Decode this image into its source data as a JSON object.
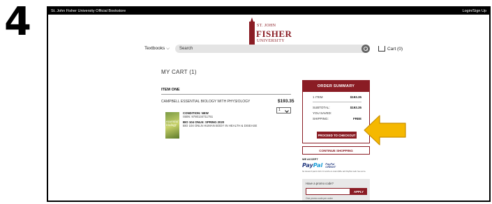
{
  "step": {
    "number": "4"
  },
  "topbar": {
    "store_name": "St. John Fisher University Official Bookstore",
    "login": "Login/Sign Up"
  },
  "logo": {
    "line1": "ST. JOHN",
    "line2": "FISHER",
    "line3": "UNIVERSITY"
  },
  "nav": {
    "textbooks": "Textbooks",
    "search_placeholder": "Search",
    "cart": "Cart (0)"
  },
  "cart": {
    "heading": "MY CART (1)",
    "item_label": "ITEM ONE",
    "product_title": "CAMPBELL ESSENTIAL BIOLOGY WITH PHYSIOLOGY",
    "price": "$193.35",
    "qty": "1",
    "book_cover_text": "essential biology",
    "condition": "CONDITION: NEW",
    "isbn": "ISBN: 9780134711751",
    "course1": "BIO 104 ONLN: SPRING 2020",
    "course2": "BIO 104 ONLN HUMAN BODY IN HEALTH & DISEASE"
  },
  "summary": {
    "heading": "ORDER SUMMARY",
    "items_label": "1 ITEM",
    "items_value": "$193.35",
    "subtotal_label": "SUBTOTAL:",
    "subtotal_value": "$193.35",
    "saved_label": "YOU SAVED:",
    "shipping_label": "SHIPPING:",
    "shipping_value": "FREE",
    "checkout": "PROCEED TO CHECKOUT"
  },
  "continue": "CONTINUE SHOPPING",
  "payment": {
    "we_accept": "WE ACCEPT",
    "paypal_p1": "Pay",
    "paypal_p2": "Pal",
    "credit_top": "PayPal",
    "credit_bottom": "CREDIT",
    "note": "No interest if paid in full in 6 months on orders $99+ with PayPal credit. See terms."
  },
  "promo": {
    "question": "Have a promo code?",
    "apply": "APPLY",
    "note": "One promo code per order"
  },
  "colors": {
    "brand": "#8a1c24",
    "arrow": "#f5b800"
  }
}
